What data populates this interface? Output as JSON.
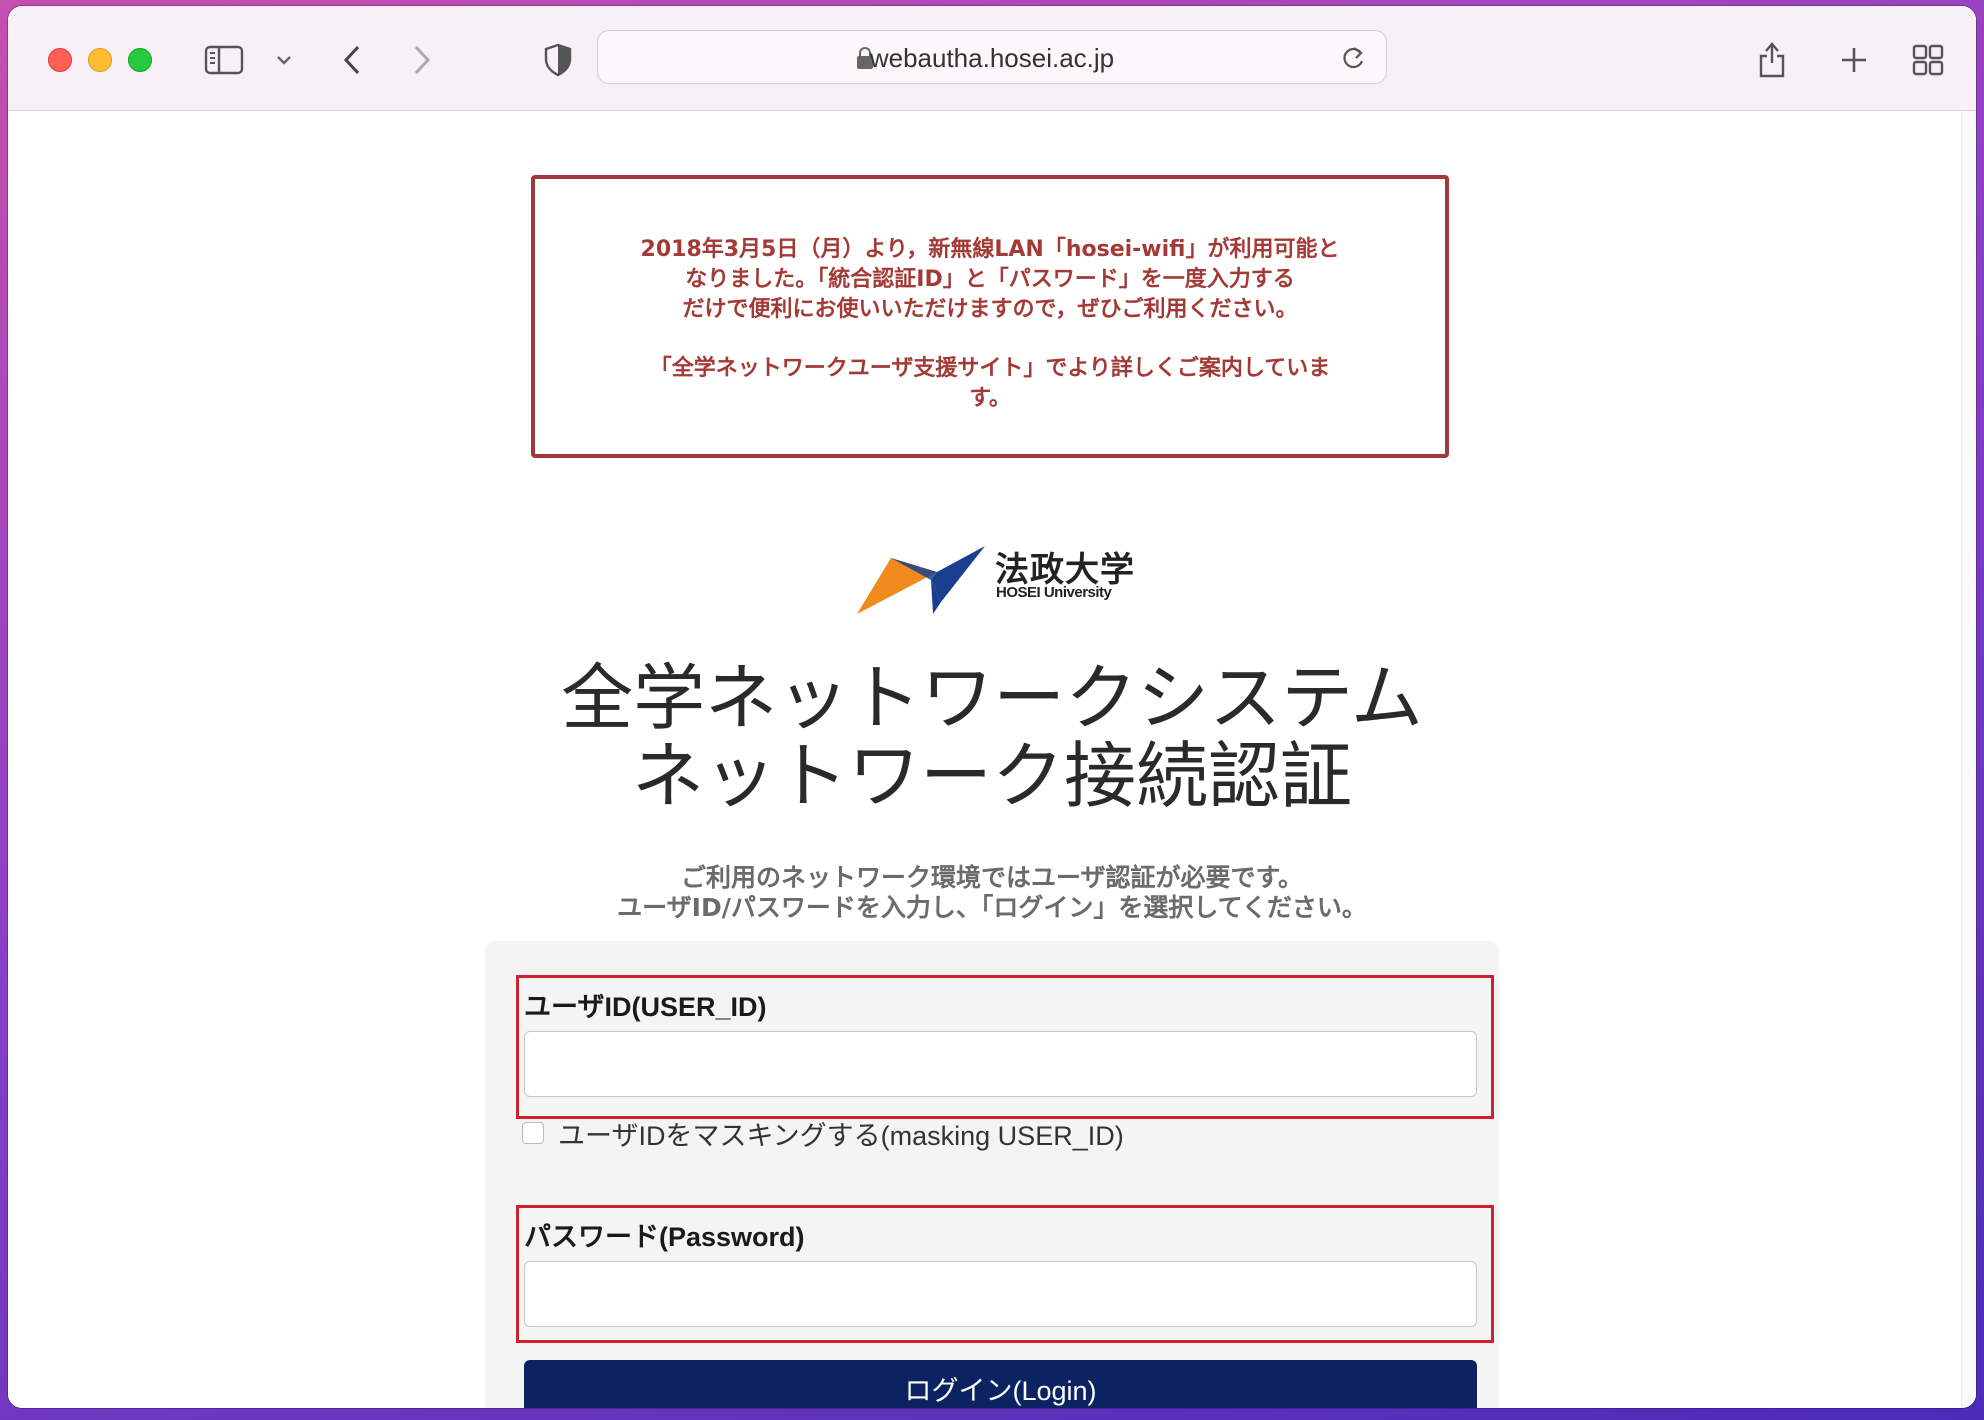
{
  "browser": {
    "url": "webautha.hosei.ac.jp",
    "icons": [
      "sidebar-icon",
      "chevron-down-icon",
      "back-icon",
      "forward-icon",
      "privacy-shield-icon",
      "lock-icon",
      "reload-icon",
      "share-icon",
      "new-tab-icon",
      "tab-overview-icon"
    ]
  },
  "notice": {
    "line1": "2018年3月5日（月）より，新無線LAN「hosei-wifi」が利用可能と",
    "line2": "なりました。「統合認証ID」と「パスワード」を一度入力する",
    "line3": "だけで便利にお使いいただけますので，ぜひご利用ください。",
    "line4": "「全学ネットワークユーザ支援サイト」でより詳しくご案内していま",
    "line5": "す。",
    "color": "#a33a36"
  },
  "logo": {
    "name_jp": "法政大学",
    "name_en": "HOSEI University",
    "colors": {
      "orange": "#f08a1e",
      "blue": "#1b3f8f"
    }
  },
  "heading": {
    "line1": "全学ネットワークシステム",
    "line2": "ネットワーク接続認証"
  },
  "instructions": {
    "line1": "ご利用のネットワーク環境ではユーザ認証が必要です。",
    "line2": "ユーザID/パスワードを入力し、「ログイン」を選択してください。"
  },
  "form": {
    "user_id_label": "ユーザID(USER_ID)",
    "user_id_value": "",
    "mask_label": "ユーザIDをマスキングする(masking USER_ID)",
    "mask_checked": false,
    "password_label": "パスワード(Password)",
    "password_value": "",
    "login_label": "ログイン(Login)",
    "highlight_color": "#d0202e",
    "button_color": "#0b2461"
  }
}
